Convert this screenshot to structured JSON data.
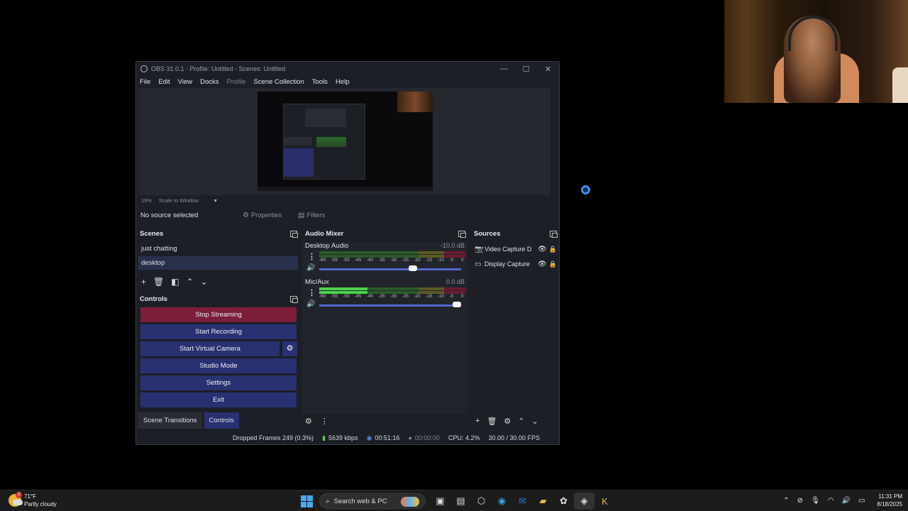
{
  "window": {
    "title": "OBS 31.0.1 - Profile: Untitled - Scenes: Untitled",
    "minimize": "—",
    "maximize": "☐",
    "close": "✕"
  },
  "menu": [
    "File",
    "Edit",
    "View",
    "Docks",
    "Profile",
    "Scene Collection",
    "Tools",
    "Help"
  ],
  "preview": {
    "zoom": "19%",
    "scale_mode": "Scale to Window"
  },
  "context": {
    "no_source": "No source selected",
    "properties": "Properties",
    "filters": "Filters"
  },
  "scenes": {
    "title": "Scenes",
    "items": [
      "just chatting",
      "desktop"
    ],
    "selected": "desktop"
  },
  "controls": {
    "title": "Controls",
    "stop_streaming": "Stop Streaming",
    "start_recording": "Start Recording",
    "start_virtual_camera": "Start Virtual Camera",
    "studio_mode": "Studio Mode",
    "settings": "Settings",
    "exit": "Exit"
  },
  "tabs": {
    "scene_transitions": "Scene Transitions",
    "controls": "Controls",
    "active": "Controls"
  },
  "mixer": {
    "title": "Audio Mixer",
    "ticks": [
      "-60",
      "-55",
      "-50",
      "-45",
      "-40",
      "-35",
      "-30",
      "-25",
      "-20",
      "-15",
      "-10",
      "-5",
      "0"
    ],
    "channels": [
      {
        "name": "Desktop Audio",
        "db": "-10.0 dB",
        "level": 0.0,
        "volume": 0.69
      },
      {
        "name": "Mic/Aux",
        "db": "0.0 dB",
        "level": 0.33,
        "volume": 1.0
      }
    ]
  },
  "sources": {
    "title": "Sources",
    "items": [
      {
        "name": "Video Capture D",
        "icon": "camera-icon"
      },
      {
        "name": "Display Capture",
        "icon": "monitor-icon"
      }
    ]
  },
  "status": {
    "dropped_frames": "Dropped Frames 249 (0.3%)",
    "bitrate": "5639 kbps",
    "stream_time": "00:51:16",
    "record_time": "00:00:00",
    "cpu": "CPU: 4.2%",
    "fps": "30.00 / 30.00 FPS"
  },
  "taskbar": {
    "weather_temp": "71°F",
    "weather_desc": "Partly cloudy",
    "weather_badge": "2",
    "search_placeholder": "Search web & PC",
    "time": "11:31 PM",
    "date": "8/18/2025"
  },
  "colors": {
    "stream_button": "#7a1e3a",
    "control_button": "#283171",
    "meter_green": "#4cd24c",
    "accent_blue": "#5566d0"
  }
}
